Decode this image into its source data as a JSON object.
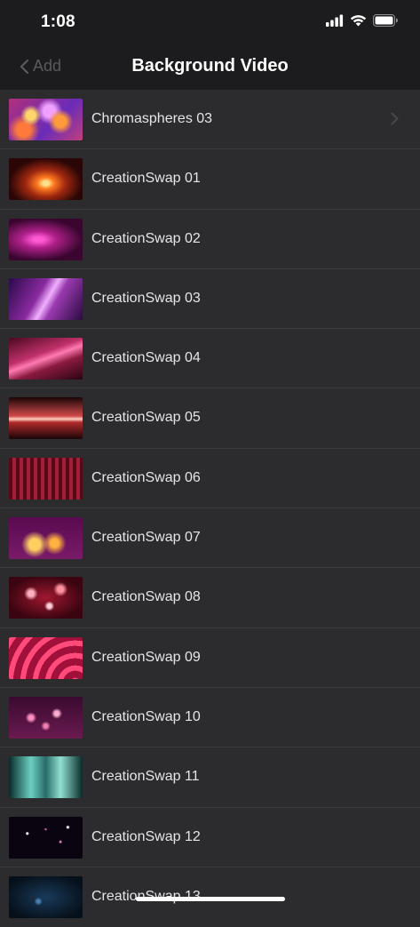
{
  "status_bar": {
    "time": "1:08"
  },
  "nav": {
    "back_label": "Add",
    "title": "Background Video"
  },
  "colors": {
    "background": "#1c1c1e",
    "row_background": "#2c2c2e",
    "divider": "#3a3a3c",
    "back_disabled": "#5a5a5e"
  },
  "videos": [
    {
      "label": "Chromaspheres 03"
    },
    {
      "label": "CreationSwap 01"
    },
    {
      "label": "CreationSwap 02"
    },
    {
      "label": "CreationSwap 03"
    },
    {
      "label": "CreationSwap 04"
    },
    {
      "label": "CreationSwap 05"
    },
    {
      "label": "CreationSwap 06"
    },
    {
      "label": "CreationSwap 07"
    },
    {
      "label": "CreationSwap 08"
    },
    {
      "label": "CreationSwap 09"
    },
    {
      "label": "CreationSwap 10"
    },
    {
      "label": "CreationSwap 11"
    },
    {
      "label": "CreationSwap 12"
    },
    {
      "label": "CreationSwap 13"
    }
  ]
}
